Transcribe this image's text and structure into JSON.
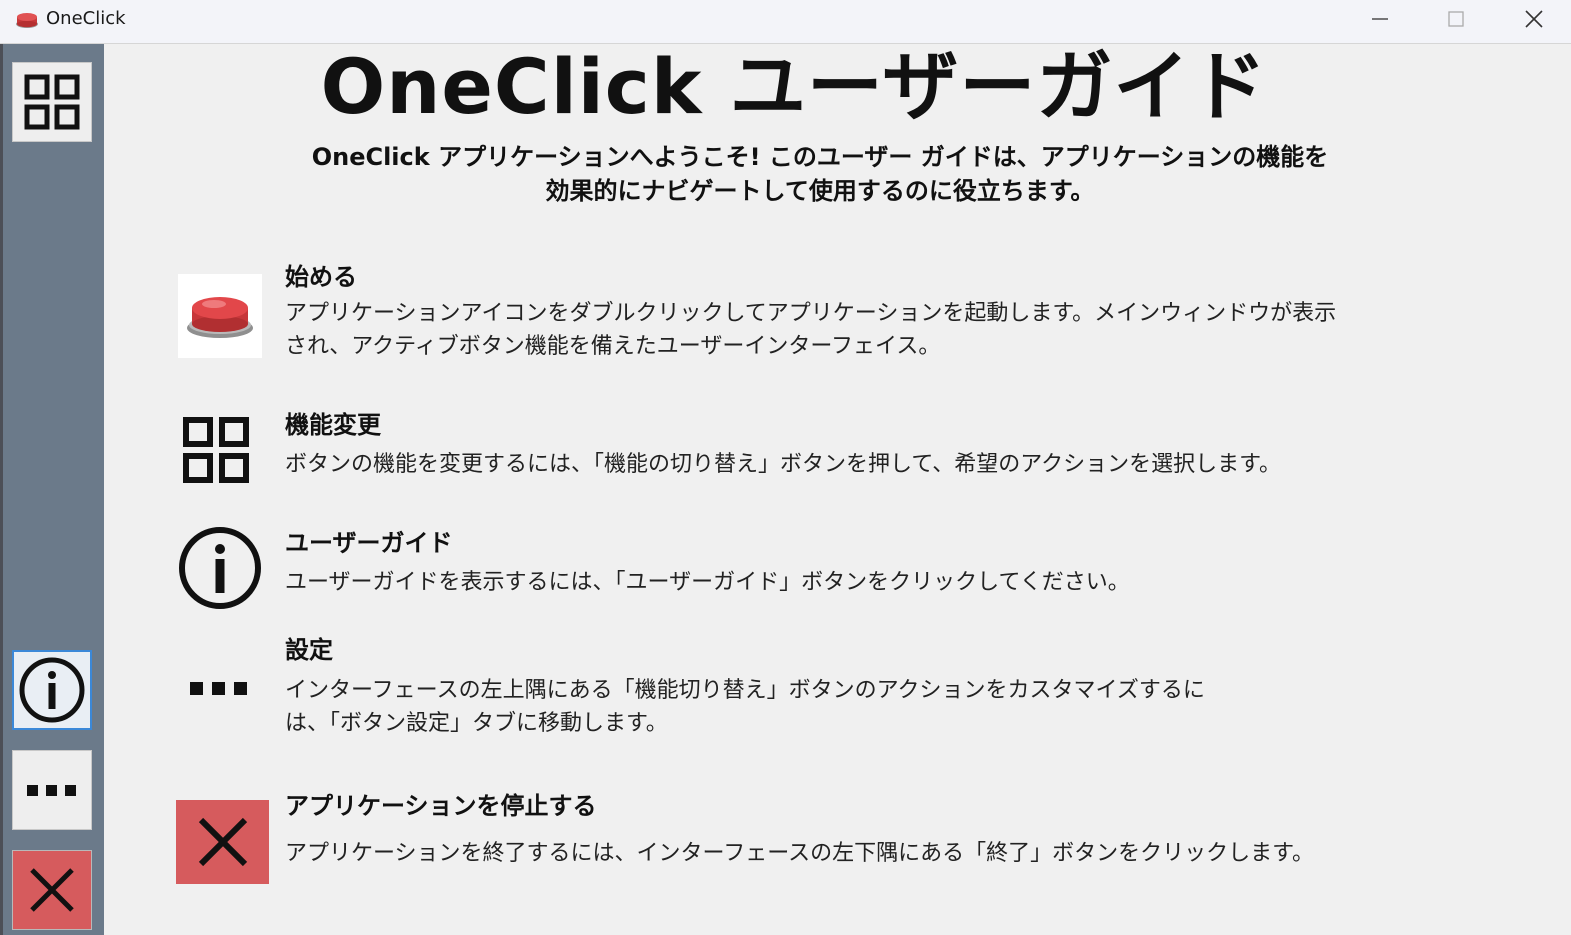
{
  "window": {
    "title": "OneClick",
    "minimize_icon": "minimize-icon",
    "maximize_icon": "maximize-icon",
    "close_icon": "close-icon"
  },
  "sidebar": {
    "items": [
      {
        "name": "function-switch",
        "icon": "grid-icon"
      },
      {
        "name": "user-guide",
        "icon": "info-icon",
        "active": true
      },
      {
        "name": "settings",
        "icon": "more-icon"
      },
      {
        "name": "exit",
        "icon": "close-icon"
      }
    ]
  },
  "main": {
    "title": "OneClick ユーザーガイド",
    "intro": "OneClick アプリケーションへようこそ! このユーザー ガイドは、アプリケーションの機能を効果的にナビゲートして使用するのに役立ちます。",
    "sections": [
      {
        "heading": "始める",
        "body": "アプリケーションアイコンをダブルクリックしてアプリケーションを起動します。メインウィンドウが表示され、アクティブボタン機能を備えたユーザーインターフェイス。",
        "icon": "red-button-icon"
      },
      {
        "heading": "機能変更",
        "body": "ボタンの機能を変更するには、「機能の切り替え」ボタンを押して、希望のアクションを選択します。",
        "icon": "grid-icon"
      },
      {
        "heading": "ユーザーガイド",
        "body": "ユーザーガイドを表示するには、「ユーザーガイド」ボタンをクリックしてください。",
        "icon": "info-icon"
      },
      {
        "heading": "設定",
        "body": "インターフェースの左上隅にある「機能切り替え」ボタンのアクションをカスタマイズするには、「ボタン設定」タブに移動します。",
        "icon": "more-icon"
      },
      {
        "heading": "アプリケーションを停止する",
        "body": "アプリケーションを終了するには、インターフェースの左下隅にある「終了」ボタンをクリックします。",
        "icon": "close-icon"
      }
    ]
  },
  "colors": {
    "sidebar": "#6b7a8a",
    "background": "#f0f0f0",
    "exit_red": "#d65b5d",
    "active_border": "#3b88d8"
  }
}
